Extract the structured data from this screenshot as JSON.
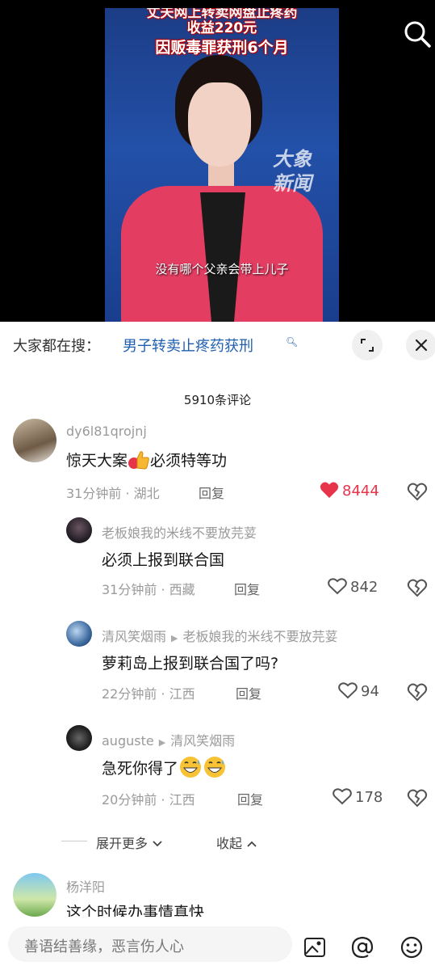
{
  "video": {
    "caption_line1": "丈夫网上转卖网盘止疼药",
    "caption_line2": "收益220元",
    "caption_line3": "因贩毒罪获刑6个月",
    "logo_text": "大象新闻",
    "subtitle": "没有哪个父亲会带上儿子"
  },
  "search": {
    "prefix": "大家都在搜：",
    "query": "男子转卖止疼药获刑",
    "query_icon": "search-icon"
  },
  "comments_count": "5910条评论",
  "comments": [
    {
      "user": "dy6l81qrojnj",
      "text_a": "惊天大案",
      "text_b": "必须特等功",
      "time": "31分钟前",
      "location": "湖北",
      "reply": "回复",
      "likes": "8444",
      "liked": true
    },
    {
      "user": "老板娘我的米线不要放芫荽",
      "text": "必须上报到联合国",
      "time": "31分钟前",
      "location": "西藏",
      "reply": "回复",
      "likes": "842"
    },
    {
      "user": "清风笑烟雨",
      "reply_to": "老板娘我的米线不要放芫荽",
      "text": "萝莉岛上报到联合国了吗?",
      "time": "22分钟前",
      "location": "江西",
      "reply": "回复",
      "likes": "94"
    },
    {
      "user": "auguste",
      "reply_to": "清风笑烟雨",
      "text": "急死你得了",
      "time": "20分钟前",
      "location": "江西",
      "reply": "回复",
      "likes": "178"
    },
    {
      "user": "杨洋阳",
      "text": "这个时候办事情真快"
    }
  ],
  "thread": {
    "expand": "展开更多",
    "collapse": "收起"
  },
  "composer": {
    "placeholder": "善语结善缘，恶言伤人心"
  },
  "colors": {
    "like_red": "#e8344b",
    "link_blue": "#1f5fb0",
    "jacket": "#e43d62"
  }
}
